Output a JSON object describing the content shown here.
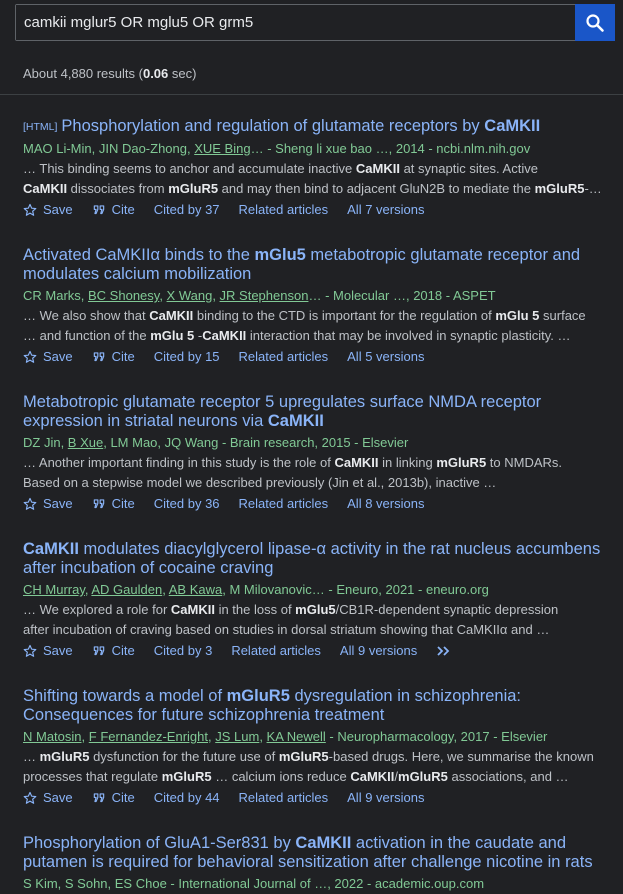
{
  "search": {
    "query": "camkii mglur5 OR mglu5 OR grm5"
  },
  "stats": {
    "prefix": "About 4,880 results (",
    "time": "0.06",
    "suffix": " sec)"
  },
  "actions": {
    "save": "Save",
    "cite": "Cite",
    "related": "Related articles"
  },
  "results": [
    {
      "tag": "[HTML]",
      "title_a": "Phosphorylation and regulation of glutamate receptors by ",
      "title_b": "CaMKII",
      "authors": [
        "MAO Li-Min, JIN Dao-Zhong, ",
        "XUE Bing"
      ],
      "source": "… - Sheng li xue bao …, 2014 - ncbi.nlm.nih.gov",
      "snip1": [
        "… This binding seems to anchor and accumulate inactive ",
        "CaMKII",
        " at synaptic sites. Active"
      ],
      "snip2": [
        "CaMKII",
        " dissociates from ",
        "mGluR5",
        " and may then bind to adjacent GluN2B to mediate the ",
        "mGluR5",
        "-…"
      ],
      "cited": "Cited by 37",
      "versions": "All 7 versions"
    },
    {
      "title_l1": [
        "Activated CaMKIIα binds to the ",
        "mGlu5",
        " metabotropic glutamate receptor and"
      ],
      "title_l2": "modulates calcium mobilization",
      "authors": [
        "CR Marks",
        "BC Shonesy",
        "X Wang",
        "JR Stephenson"
      ],
      "source": "… - Molecular …, 2018 - ASPET",
      "snip1": [
        "… We also show that ",
        "CaMKII",
        " binding to the CTD is important for the regulation of ",
        "mGlu 5",
        " surface"
      ],
      "snip2": [
        "… and function of the ",
        "mGlu 5",
        " -",
        "CaMKII",
        " interaction that may be involved in synaptic plasticity. …"
      ],
      "cited": "Cited by 15",
      "versions": "All 5 versions"
    },
    {
      "title_l1": "Metabotropic glutamate receptor 5 upregulates surface NMDA receptor",
      "title_l2": [
        "expression in striatal neurons via ",
        "CaMKII"
      ],
      "authors": [
        "DZ Jin",
        "B Xue"
      ],
      "authors_rest": ", LM Mao, JQ Wang - Brain research, 2015 - Elsevier",
      "snip1": [
        "… Another important finding in this study is the role of ",
        "CaMKII",
        " in linking ",
        "mGluR5",
        " to NMDARs."
      ],
      "snip2": "Based on a stepwise model we described previously (Jin et al., 2013b), inactive …",
      "cited": "Cited by 36",
      "versions": "All 8 versions"
    },
    {
      "title_l1": [
        "CaMKII",
        " modulates diacylglycerol lipase-α activity in the rat nucleus accumbens"
      ],
      "title_l2": "after incubation of cocaine craving",
      "authors": [
        "CH Murray",
        "AD Gaulden",
        "AB Kawa"
      ],
      "authors_rest": ", M Milovanovic… - Eneuro, 2021 - eneuro.org",
      "snip1": [
        "… We explored a role for ",
        "CaMKII",
        " in the loss of ",
        "mGlu5",
        "/CB1R-dependent synaptic depression"
      ],
      "snip2": "after incubation of craving based on studies in dorsal striatum showing that CaMKIIα and …",
      "cited": "Cited by 3",
      "versions": "All 9 versions"
    },
    {
      "title_l1": [
        "Shifting towards a model of ",
        "mGluR5",
        " dysregulation in schizophrenia:"
      ],
      "title_l2": "Consequences for future schizophrenia treatment",
      "authors": [
        "N Matosin",
        "F Fernandez-Enright",
        "JS Lum",
        "KA Newell"
      ],
      "source": " - Neuropharmacology, 2017 - Elsevier",
      "snip1": [
        "… ",
        "mGluR5",
        " dysfunction for the future use of ",
        "mGluR5",
        "-based drugs. Here, we summarise the known"
      ],
      "snip2": [
        "processes that regulate ",
        "mGluR5",
        " … calcium ions reduce ",
        "CaMKII",
        "/",
        "mGluR5",
        " associations, and …"
      ],
      "cited": "Cited by 44",
      "versions": "All 9 versions"
    },
    {
      "title_l1": [
        "Phosphorylation of GluA1-Ser831 by ",
        "CaMKII",
        " activation in the caudate and"
      ],
      "title_l2": "putamen is required for behavioral sensitization after challenge nicotine in rats",
      "meta": "S Kim, S Sohn, ES Choe - International Journal of …, 2022 - academic.oup.com"
    }
  ]
}
